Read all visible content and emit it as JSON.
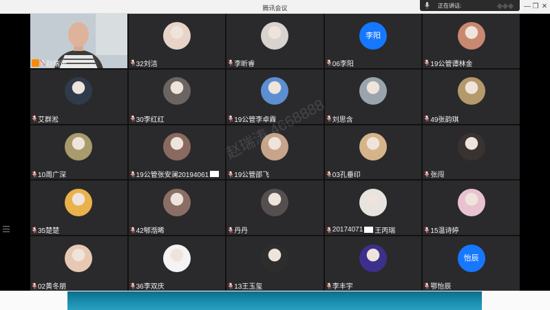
{
  "window": {
    "title": "腾讯会议",
    "speaking_label": "正在讲话:"
  },
  "watermark": "赵瑞涛  4668888",
  "participants": [
    {
      "name": "赵瑞涛",
      "kind": "video",
      "host": true
    },
    {
      "name": "32刘洁",
      "kind": "avatar",
      "color": "#e7d3c8"
    },
    {
      "name": "李昕睿",
      "kind": "avatar",
      "color": "#d9d3d0"
    },
    {
      "name": "06李阳",
      "kind": "letter",
      "letter": "李阳"
    },
    {
      "name": "19公管谭林金",
      "kind": "avatar",
      "color": "#c98870"
    },
    {
      "name": "艾群淞",
      "kind": "avatar",
      "color": "#2f3b4a"
    },
    {
      "name": "30李红红",
      "kind": "avatar",
      "color": "#6b6460"
    },
    {
      "name": "19公管李卓霖",
      "kind": "avatar",
      "color": "#5b8fd1"
    },
    {
      "name": "刘思含",
      "kind": "avatar",
      "color": "#9aa4ad"
    },
    {
      "name": "49张韵琪",
      "kind": "avatar",
      "color": "#b49a6a"
    },
    {
      "name": "10周广深",
      "kind": "avatar",
      "color": "#a89b6d"
    },
    {
      "name": "19公管张安澜20194061",
      "kind": "avatar",
      "color": "#8a6a60",
      "redacted_suffix": true
    },
    {
      "name": "19公管邵飞",
      "kind": "avatar",
      "color": "#c7a58a"
    },
    {
      "name": "03孔垂印",
      "kind": "avatar",
      "color": "#d6b48a"
    },
    {
      "name": "张闯",
      "kind": "avatar",
      "color": "#3a3230"
    },
    {
      "name": "35楚楚",
      "kind": "avatar",
      "color": "#e9b24a"
    },
    {
      "name": "42郇湉晞",
      "kind": "avatar",
      "color": "#8b6f66"
    },
    {
      "name": "丹丹",
      "kind": "avatar",
      "color": "#55504f"
    },
    {
      "name": "20174071",
      "suffix": "王丙瑞",
      "kind": "avatar",
      "color": "#e7e3df",
      "redacted_middle": true
    },
    {
      "name": "15温诗婷",
      "kind": "avatar",
      "color": "#e8c3cf"
    },
    {
      "name": "02黄冬朋",
      "kind": "avatar",
      "color": "#e7c9b3"
    },
    {
      "name": "36李双庆",
      "kind": "avatar",
      "color": "#f4f4f4"
    },
    {
      "name": "13王玉玺",
      "kind": "avatar",
      "color": "#2d2d2d"
    },
    {
      "name": "李丰宇",
      "kind": "avatar",
      "color": "#3d2f8c"
    },
    {
      "name": "鄂怡辰",
      "kind": "letter",
      "letter": "怡辰"
    }
  ]
}
